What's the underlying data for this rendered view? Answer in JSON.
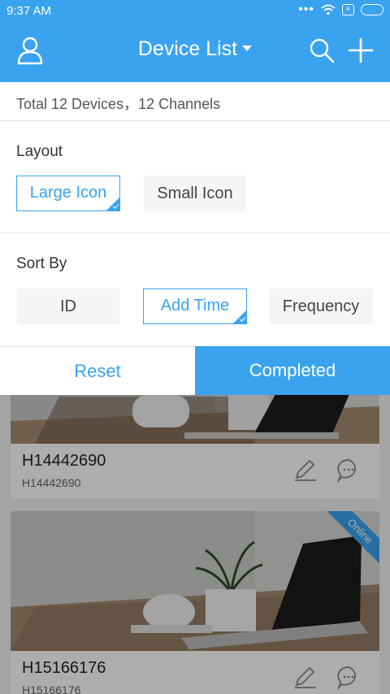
{
  "status_bar": {
    "time": "9:37 AM",
    "dots": "•••"
  },
  "header": {
    "title": "Device List",
    "icons": [
      "user-icon",
      "search-icon",
      "add-icon"
    ]
  },
  "summary": "Total 12 Devices，12 Channels",
  "layout": {
    "title": "Layout",
    "options": [
      {
        "label": "Large Icon",
        "selected": true
      },
      {
        "label": "Small Icon",
        "selected": false
      }
    ]
  },
  "sort": {
    "title": "Sort By",
    "options": [
      {
        "label": "ID",
        "selected": false
      },
      {
        "label": "Add Time",
        "selected": true
      },
      {
        "label": "Frequency",
        "selected": false
      }
    ]
  },
  "buttons": {
    "reset": "Reset",
    "completed": "Completed"
  },
  "devices": [
    {
      "name": "H14442690",
      "id": "H14442690",
      "online": false
    },
    {
      "name": "H15166176",
      "id": "H15166176",
      "online": true,
      "badge": "Online"
    }
  ],
  "colors": {
    "accent": "#3aa3f0",
    "dim_overlay": "rgba(0,0,0,0.32)"
  }
}
